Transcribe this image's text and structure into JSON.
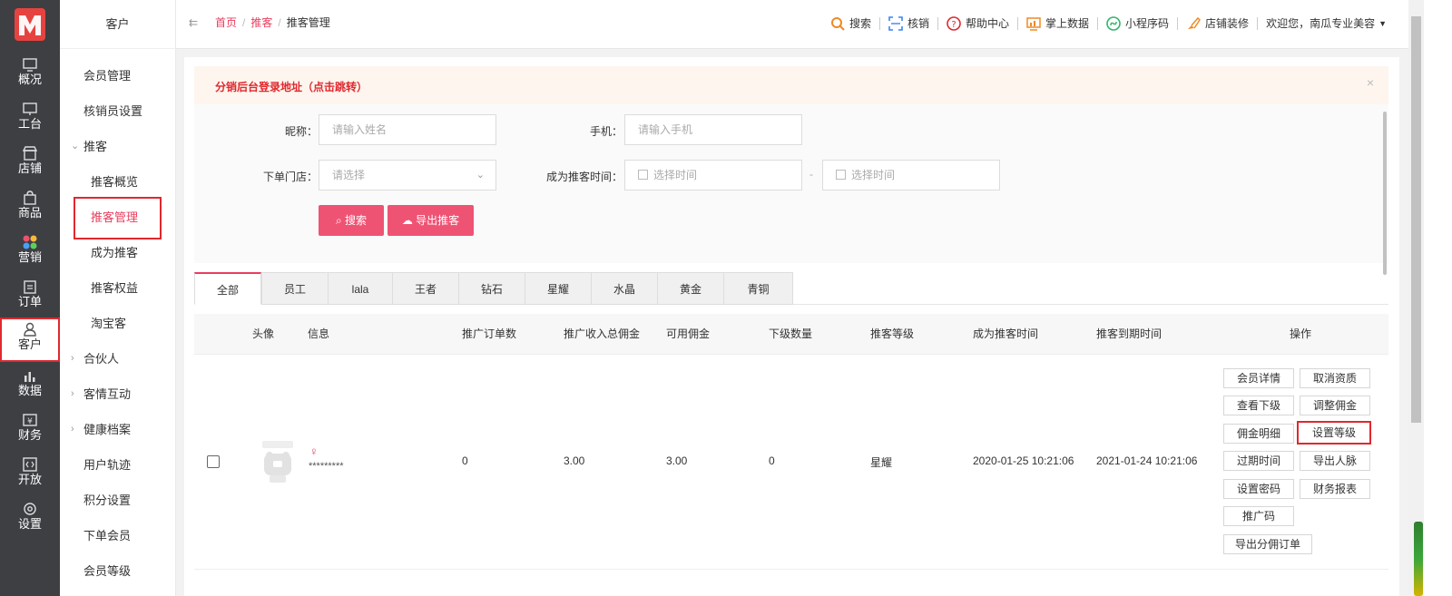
{
  "rail": {
    "items": [
      {
        "label": "概况",
        "icon": "monitor-icon"
      },
      {
        "label": "工台",
        "icon": "desktop-icon"
      },
      {
        "label": "店铺",
        "icon": "store-icon"
      },
      {
        "label": "商品",
        "icon": "bag-icon"
      },
      {
        "label": "营销",
        "icon": "flower-icon"
      },
      {
        "label": "订单",
        "icon": "clipboard-icon"
      },
      {
        "label": "客户",
        "icon": "user-icon"
      },
      {
        "label": "数据",
        "icon": "bar-chart-icon"
      },
      {
        "label": "财务",
        "icon": "yen-icon"
      },
      {
        "label": "开放",
        "icon": "code-icon"
      },
      {
        "label": "设置",
        "icon": "gear-icon"
      }
    ],
    "active": "客户"
  },
  "subnav": {
    "title": "客户",
    "items": [
      {
        "label": "会员管理"
      },
      {
        "label": "核销员设置"
      },
      {
        "label": "推客"
      },
      {
        "label": "推客概览"
      },
      {
        "label": "推客管理"
      },
      {
        "label": "成为推客"
      },
      {
        "label": "推客权益"
      },
      {
        "label": "淘宝客"
      },
      {
        "label": "合伙人"
      },
      {
        "label": "客情互动"
      },
      {
        "label": "健康档案"
      },
      {
        "label": "用户轨迹"
      },
      {
        "label": "积分设置"
      },
      {
        "label": "下单会员"
      },
      {
        "label": "会员等级"
      }
    ]
  },
  "header": {
    "breadcrumb": [
      "首页",
      "推客",
      "推客管理"
    ],
    "tools": [
      "搜索",
      "核销",
      "帮助中心",
      "掌上数据",
      "小程序码",
      "店铺装修"
    ],
    "welcome": "欢迎您，南瓜专业美容",
    "accent_color": "#e83e5e"
  },
  "alert": {
    "text": "分销后台登录地址（点击跳转）",
    "close": "×"
  },
  "filter": {
    "nickname_label": "昵称：",
    "nickname_placeholder": "请输入姓名",
    "phone_label": "手机：",
    "phone_placeholder": "请输入手机",
    "store_label": "下单门店：",
    "store_placeholder": "请选择",
    "time_label": "成为推客时间：",
    "time_start_placeholder": "选择时间",
    "time_end_placeholder": "选择时间",
    "time_sep": "-",
    "search_button": "搜索",
    "export_button": "导出推客"
  },
  "tabs": [
    "全部",
    "员工",
    "lala",
    "王者",
    "钻石",
    "星耀",
    "水晶",
    "黄金",
    "青铜"
  ],
  "table": {
    "headers": [
      "头像",
      "信息",
      "推广订单数",
      "推广收入总佣金",
      "可用佣金",
      "下级数量",
      "推客等级",
      "成为推客时间",
      "推客到期时间",
      "操作"
    ],
    "row": {
      "gender": "♀",
      "info": "*********",
      "orders": "0",
      "total_commission": "3.00",
      "available_commission": "3.00",
      "subordinates": "0",
      "level": "星耀",
      "joined": "2020-01-25 10:21:06",
      "expires": "2021-01-24 10:21:06",
      "actions": [
        "会员详情",
        "取消资质",
        "查看下级",
        "调整佣金",
        "佣金明细",
        "设置等级",
        "过期时间",
        "导出人脉",
        "设置密码",
        "财务报表",
        "推广码",
        "导出分佣订单"
      ]
    }
  }
}
